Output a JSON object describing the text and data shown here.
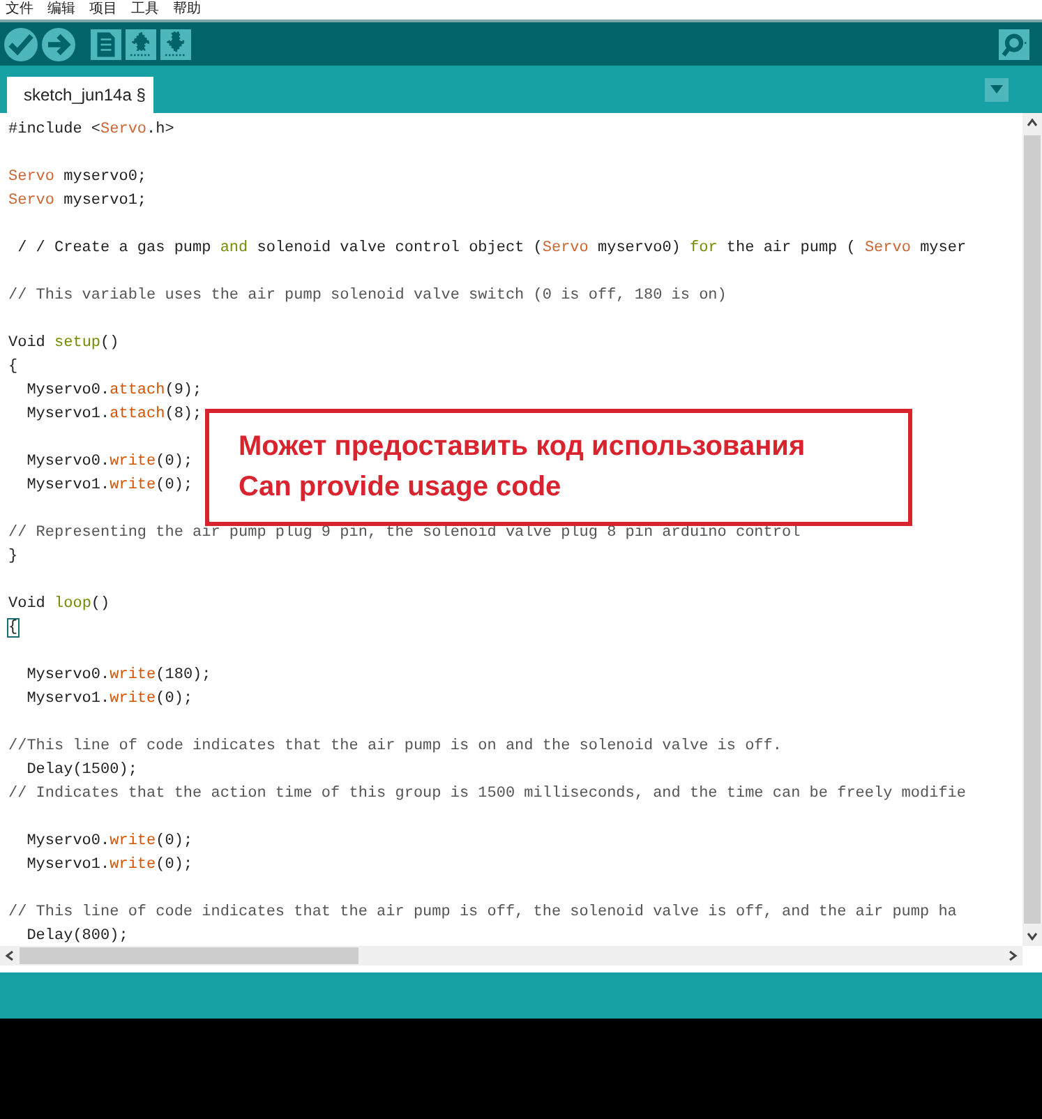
{
  "menu": [
    "文件",
    "编辑",
    "项目",
    "工具",
    "帮助"
  ],
  "toolbar": {
    "left": [
      {
        "kind": "verify"
      },
      {
        "kind": "upload"
      },
      {
        "kind": "new"
      },
      {
        "kind": "open"
      },
      {
        "kind": "save"
      }
    ],
    "right": [
      {
        "kind": "monitor"
      }
    ]
  },
  "tabs": [
    {
      "label": "sketch_jun14a",
      "mark": "§",
      "selected": true
    }
  ],
  "editor": {
    "lines": [
      {
        "kind": "code",
        "segments": [
          {
            "text": "#include <",
            "kind": "plain"
          },
          {
            "text": "Servo",
            "kind": "type"
          },
          {
            "text": ".h>",
            "kind": "plain"
          }
        ]
      },
      {
        "kind": "blank"
      },
      {
        "kind": "code",
        "segments": [
          {
            "text": "Servo",
            "kind": "type"
          },
          {
            "text": " myservo0;",
            "kind": "plain"
          }
        ]
      },
      {
        "kind": "code",
        "segments": [
          {
            "text": "Servo",
            "kind": "type"
          },
          {
            "text": " myservo1;",
            "kind": "plain"
          }
        ]
      },
      {
        "kind": "blank"
      },
      {
        "kind": "code",
        "segments": [
          {
            "text": " / / Create a gas pump ",
            "kind": "plain"
          },
          {
            "text": "and",
            "kind": "keyword"
          },
          {
            "text": " solenoid valve control object (",
            "kind": "plain"
          },
          {
            "text": "Servo",
            "kind": "type"
          },
          {
            "text": " myservo0) ",
            "kind": "plain"
          },
          {
            "text": "for",
            "kind": "keyword"
          },
          {
            "text": " the air pump ( ",
            "kind": "plain"
          },
          {
            "text": "Servo",
            "kind": "type"
          },
          {
            "text": " myser",
            "kind": "plain"
          }
        ]
      },
      {
        "kind": "blank"
      },
      {
        "kind": "code",
        "segments": [
          {
            "text": "// This variable uses the air pump solenoid valve switch (0 is off, 180 is on)",
            "kind": "comment"
          }
        ]
      },
      {
        "kind": "blank"
      },
      {
        "kind": "code",
        "segments": [
          {
            "text": "Void ",
            "kind": "plain"
          },
          {
            "text": "setup",
            "kind": "keyword"
          },
          {
            "text": "()",
            "kind": "plain"
          }
        ]
      },
      {
        "kind": "code",
        "segments": [
          {
            "text": "{",
            "kind": "plain"
          }
        ]
      },
      {
        "kind": "code",
        "segments": [
          {
            "text": "  Myservo0.",
            "kind": "plain"
          },
          {
            "text": "attach",
            "kind": "function"
          },
          {
            "text": "(9);",
            "kind": "plain"
          }
        ]
      },
      {
        "kind": "code",
        "segments": [
          {
            "text": "  Myservo1.",
            "kind": "plain"
          },
          {
            "text": "attach",
            "kind": "function"
          },
          {
            "text": "(8);",
            "kind": "plain"
          }
        ]
      },
      {
        "kind": "blank"
      },
      {
        "kind": "code",
        "segments": [
          {
            "text": "  Myservo0.",
            "kind": "plain"
          },
          {
            "text": "write",
            "kind": "function"
          },
          {
            "text": "(0);",
            "kind": "plain"
          }
        ]
      },
      {
        "kind": "code",
        "segments": [
          {
            "text": "  Myservo1.",
            "kind": "plain"
          },
          {
            "text": "write",
            "kind": "function"
          },
          {
            "text": "(0);",
            "kind": "plain"
          }
        ]
      },
      {
        "kind": "blank"
      },
      {
        "kind": "code",
        "segments": [
          {
            "text": "// Representing the air pump plug 9 pin, the solenoid valve plug 8 pin arduino control",
            "kind": "comment"
          }
        ]
      },
      {
        "kind": "code",
        "segments": [
          {
            "text": "}",
            "kind": "plain"
          }
        ]
      },
      {
        "kind": "blank"
      },
      {
        "kind": "code",
        "segments": [
          {
            "text": "Void ",
            "kind": "plain"
          },
          {
            "text": "loop",
            "kind": "keyword"
          },
          {
            "text": "()",
            "kind": "plain"
          }
        ]
      },
      {
        "kind": "code",
        "segments": [
          {
            "text": "{",
            "kind": "bracket"
          }
        ]
      },
      {
        "kind": "blank"
      },
      {
        "kind": "code",
        "segments": [
          {
            "text": "  Myservo0.",
            "kind": "plain"
          },
          {
            "text": "write",
            "kind": "function"
          },
          {
            "text": "(180);",
            "kind": "plain"
          }
        ]
      },
      {
        "kind": "code",
        "segments": [
          {
            "text": "  Myservo1.",
            "kind": "plain"
          },
          {
            "text": "write",
            "kind": "function"
          },
          {
            "text": "(0);",
            "kind": "plain"
          }
        ]
      },
      {
        "kind": "blank"
      },
      {
        "kind": "code",
        "segments": [
          {
            "text": "//This line of code indicates that the air pump is on and the solenoid valve is off.",
            "kind": "comment"
          }
        ]
      },
      {
        "kind": "code",
        "segments": [
          {
            "text": "  Delay(1500);",
            "kind": "plain"
          }
        ]
      },
      {
        "kind": "code",
        "segments": [
          {
            "text": "// Indicates that the action time of this group is 1500 milliseconds, and the time can be freely modifie",
            "kind": "comment"
          }
        ]
      },
      {
        "kind": "blank"
      },
      {
        "kind": "code",
        "segments": [
          {
            "text": "  Myservo0.",
            "kind": "plain"
          },
          {
            "text": "write",
            "kind": "function"
          },
          {
            "text": "(0);",
            "kind": "plain"
          }
        ]
      },
      {
        "kind": "code",
        "segments": [
          {
            "text": "  Myservo1.",
            "kind": "plain"
          },
          {
            "text": "write",
            "kind": "function"
          },
          {
            "text": "(0);",
            "kind": "plain"
          }
        ]
      },
      {
        "kind": "blank"
      },
      {
        "kind": "code",
        "segments": [
          {
            "text": "// This line of code indicates that the air pump is off, the solenoid valve is off, and the air pump ha",
            "kind": "comment"
          }
        ]
      },
      {
        "kind": "code",
        "segments": [
          {
            "text": "  Delay(800);",
            "kind": "plain"
          }
        ]
      }
    ]
  },
  "notice": [
    "Может предоставить код использования",
    "Can provide usage code"
  ]
}
